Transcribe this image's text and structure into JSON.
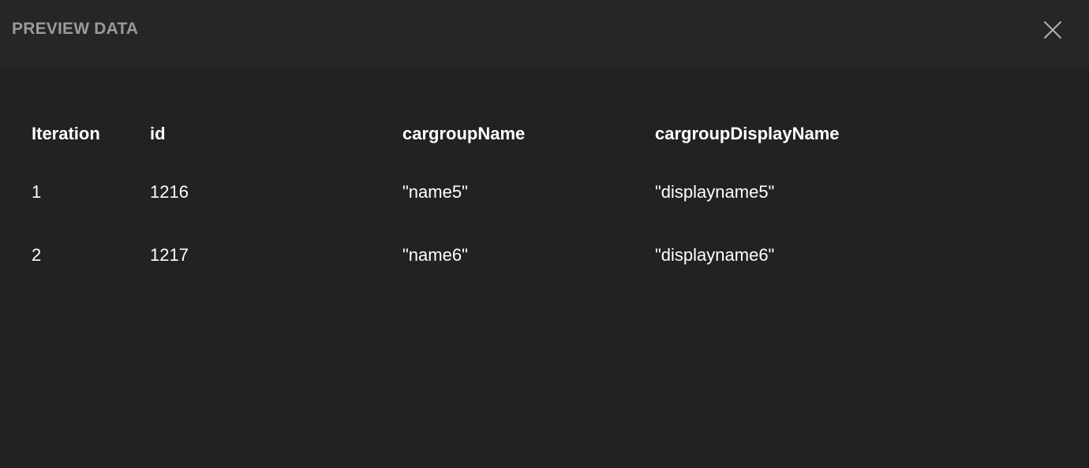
{
  "modal": {
    "title": "PREVIEW DATA",
    "close_icon": "close-icon"
  },
  "table": {
    "columns": [
      "Iteration",
      "id",
      "cargroupName",
      "cargroupDisplayName"
    ],
    "rows": [
      [
        "1",
        "1216",
        "\"name5\"",
        "\"displayname5\""
      ],
      [
        "2",
        "1217",
        "\"name6\"",
        "\"displayname6\""
      ]
    ]
  },
  "colors": {
    "background": "#222222",
    "header_background": "#262626",
    "title": "#9a9a9a",
    "text": "#ffffff"
  }
}
